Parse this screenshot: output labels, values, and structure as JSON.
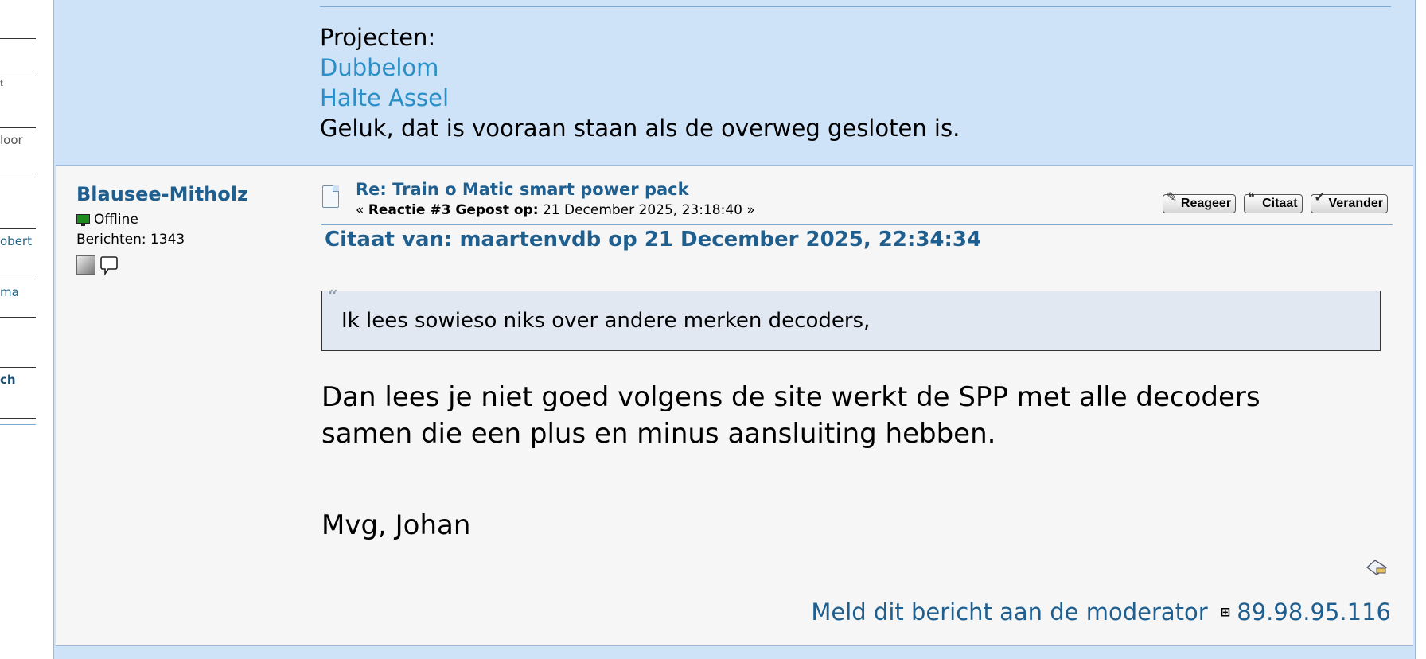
{
  "sidebar": {
    "fragments": [
      "t",
      "loor",
      "obert",
      "ma",
      "ch"
    ]
  },
  "previous_post": {
    "signature": {
      "heading": "Projecten:",
      "links": [
        "Dubbelom",
        "Halte Assel"
      ],
      "motto": "Geluk, dat is vooraan staan als de overweg gesloten is."
    }
  },
  "post": {
    "poster": {
      "name": "Blausee-Mitholz",
      "status": "Offline",
      "posts_label": "Berichten: 1343"
    },
    "title": "Re: Train o Matic smart power pack",
    "meta": {
      "prefix": "«",
      "label": "Reactie #3 Gepost op:",
      "date": "21 December 2025, 23:18:40",
      "suffix": "»"
    },
    "buttons": [
      "Reageer",
      "Citaat",
      "Verander"
    ],
    "quote": {
      "header": "Citaat van: maartenvdb op 21 December 2025, 22:34:34",
      "text": "Ik lees sowieso niks over andere merken decoders,"
    },
    "body": {
      "line1": "Dan lees je niet goed volgens de site werkt de SPP met alle decoders",
      "line2": "samen die een plus en minus aansluiting hebben.",
      "signoff": "Mvg, Johan"
    },
    "footer": {
      "report_link": "Meld dit bericht aan de moderator",
      "ip": "89.98.95.116"
    }
  },
  "colors": {
    "link": "#1f5f8f",
    "signature_link": "#2a8fc7",
    "post_bg": "#f6f6f6",
    "alt_bg": "#cfe3f8",
    "quote_bg": "#e1e8f1"
  },
  "icons": [
    "document-icon",
    "monitor-status-icon",
    "profile-icon",
    "message-icon",
    "reply-icon",
    "quote-icon",
    "modify-icon",
    "edit-icon",
    "ip-icon"
  ]
}
